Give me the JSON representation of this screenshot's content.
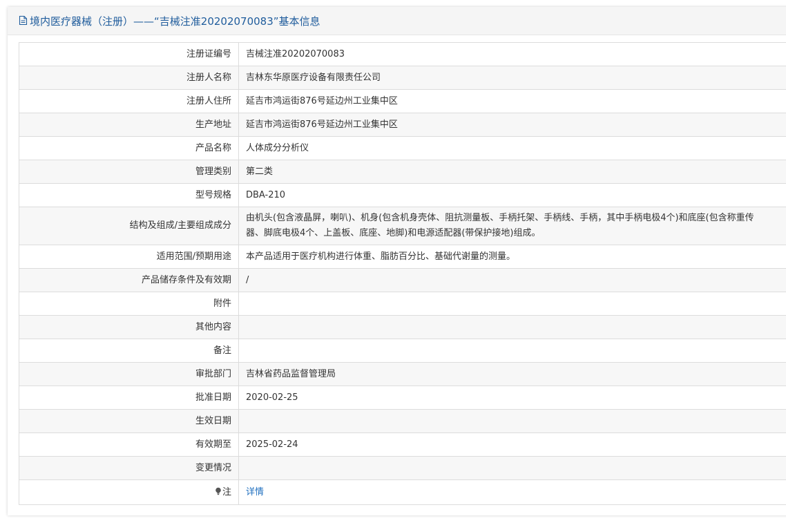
{
  "header": {
    "title": "境内医疗器械（注册）——“吉械注准20202070083”基本信息",
    "icon": "document-icon",
    "title_color": "#1f5c9c"
  },
  "rows": [
    {
      "label": "注册证编号",
      "value": "吉械注准20202070083"
    },
    {
      "label": "注册人名称",
      "value": "吉林东华原医疗设备有限责任公司"
    },
    {
      "label": "注册人住所",
      "value": "延吉市鸿运街876号延边州工业集中区"
    },
    {
      "label": "生产地址",
      "value": "延吉市鸿运街876号延边州工业集中区"
    },
    {
      "label": "产品名称",
      "value": "人体成分分析仪"
    },
    {
      "label": "管理类别",
      "value": "第二类"
    },
    {
      "label": "型号规格",
      "value": "DBA-210"
    },
    {
      "label": "结构及组成/主要组成成分",
      "value_line1": "由机头(包含液晶屏，喇叭)、机身(包含机身壳体、阻抗测量板、手柄托架、手柄线、手柄，其中手柄电极4个)和底座(包含称重传",
      "value_line2": "器、脚底电极4个、上盖板、底座、地脚)和电源适配器(带保护接地)组成。"
    },
    {
      "label": "适用范围/预期用途",
      "value": "本产品适用于医疗机构进行体重、脂肪百分比、基础代谢量的测量。"
    },
    {
      "label": "产品储存条件及有效期",
      "value": "/"
    },
    {
      "label": "附件",
      "value": ""
    },
    {
      "label": "其他内容",
      "value": ""
    },
    {
      "label": "备注",
      "value": ""
    },
    {
      "label": "审批部门",
      "value": "吉林省药品监督管理局"
    },
    {
      "label": "批准日期",
      "value": "2020-02-25"
    },
    {
      "label": "生效日期",
      "value": ""
    },
    {
      "label": "有效期至",
      "value": "2025-02-24"
    },
    {
      "label": "变更情况",
      "value": ""
    },
    {
      "label": "注",
      "value": "详情",
      "icon": "lightbulb-icon"
    }
  ],
  "colors": {
    "accent": "#1f5c9c",
    "link": "#1f6fbf",
    "row_alt": "#f7f7f7",
    "border": "#dcdcdc"
  }
}
